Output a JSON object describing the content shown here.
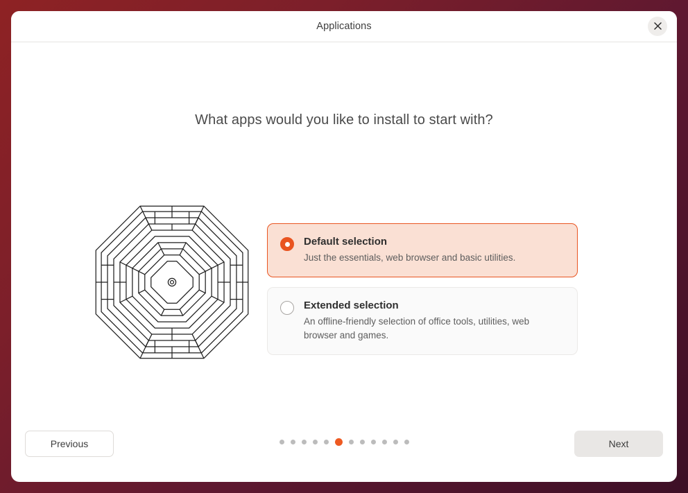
{
  "window": {
    "title": "Applications",
    "close_icon": "close-icon"
  },
  "page": {
    "heading": "What apps would you like to install to start with?",
    "illustration": "maze-illustration"
  },
  "options": [
    {
      "title": "Default selection",
      "description": "Just the essentials, web browser and basic utilities.",
      "selected": true
    },
    {
      "title": "Extended selection",
      "description": "An offline-friendly selection of office tools, utilities, web browser and games.",
      "selected": false
    }
  ],
  "footer": {
    "previous_label": "Previous",
    "next_label": "Next",
    "pagination": {
      "total": 12,
      "active_index": 6
    }
  },
  "colors": {
    "accent": "#e95420",
    "accent_dot": "#ee5a22",
    "selected_card_bg": "#fae0d4",
    "unselected_card_bg": "#fafafa",
    "window_bg": "#ffffff",
    "next_button_bg": "#e9e7e5",
    "desktop_backdrop": "#7c1f2a"
  }
}
